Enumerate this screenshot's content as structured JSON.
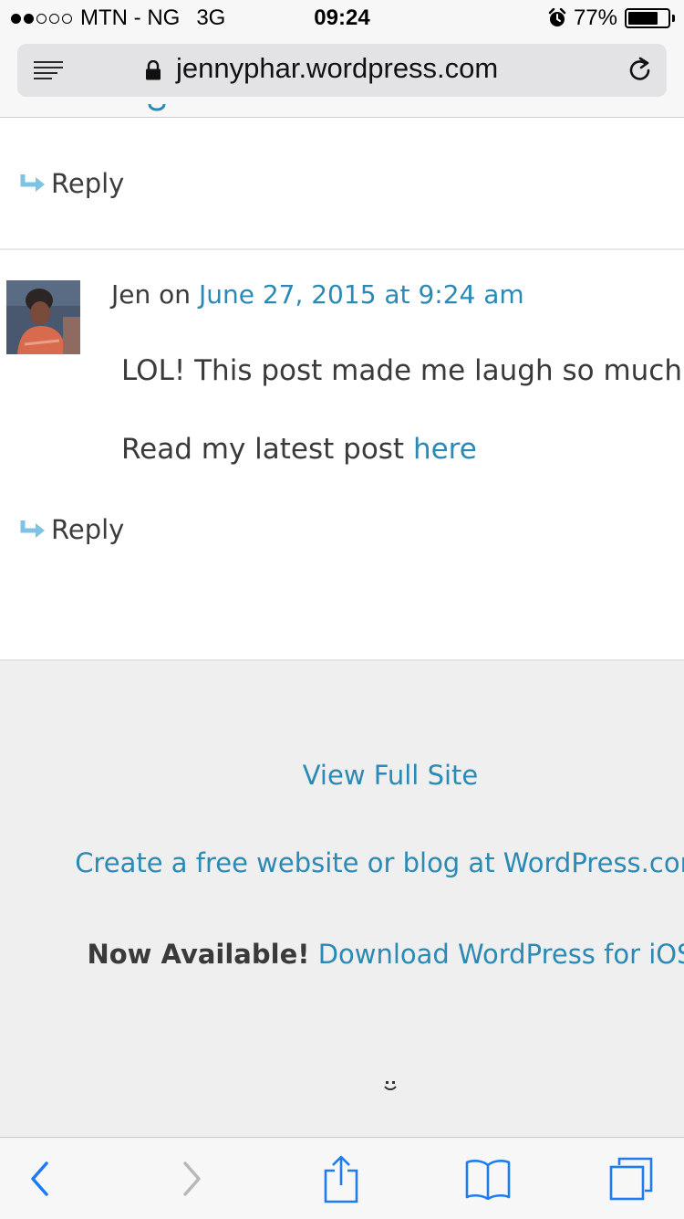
{
  "status_bar": {
    "signal_bars_filled": 2,
    "signal_bars_total": 5,
    "carrier": "MTN - NG",
    "network": "3G",
    "time": "09:24",
    "battery_percent": "77%",
    "battery_level": 0.77
  },
  "browser": {
    "url": "jennyphar.wordpress.com"
  },
  "comments": {
    "reply_label": "Reply",
    "comment": {
      "author": "Jen",
      "on_word": "on",
      "date": "June 27, 2015 at 9:24 am",
      "body": "LOL! This post made me laugh so much!",
      "latest_prefix": "Read my latest post",
      "latest_link": "here"
    }
  },
  "footer": {
    "view_full_site": "View Full Site",
    "create_blog": "Create a free website or blog at WordPress.com",
    "now_available": "Now Available!",
    "download_app": "Download WordPress for iOS"
  },
  "colors": {
    "link": "#2a8ab5",
    "reply_arrow": "#7cc3e4",
    "toolbar_icon": "#1c7cf0",
    "toolbar_disabled": "#b8b8b8"
  }
}
